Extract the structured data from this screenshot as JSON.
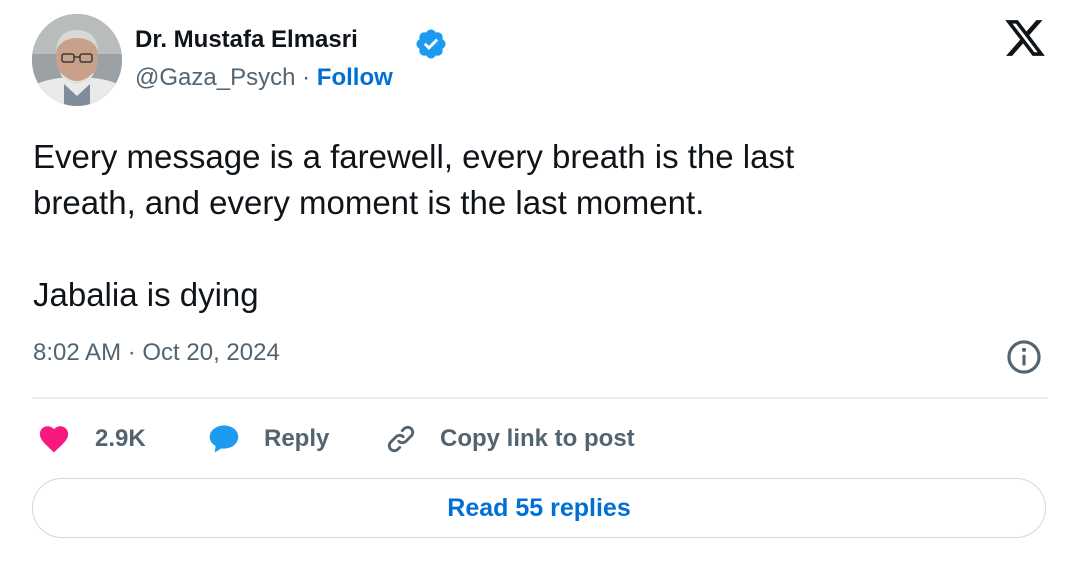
{
  "author": {
    "name": "Dr. Mustafa Elmasri",
    "handle": "@Gaza_Psych",
    "separator": "·",
    "follow_label": "Follow"
  },
  "icons": {
    "verified": "verified-badge-icon",
    "x_logo": "x-logo-icon",
    "info": "info-icon",
    "like": "heart-icon",
    "reply": "speech-bubble-icon",
    "copy_link": "link-icon"
  },
  "tweet": {
    "lines": [
      "Every message is a farewell, every breath is the last",
      "breath, and every moment is the last moment.",
      "Jabalia is dying"
    ],
    "timestamp": "8:02 AM · Oct 20, 2024"
  },
  "actions": {
    "like_count": "2.9K",
    "reply_label": "Reply",
    "copy_link_label": "Copy link to post"
  },
  "read_replies_label": "Read 55 replies",
  "colors": {
    "heart": "#f91880",
    "reply_bubble": "#1d9bf0",
    "link_blue": "#006fd6",
    "muted_text": "#536471",
    "verified": "#1d9bf0"
  }
}
